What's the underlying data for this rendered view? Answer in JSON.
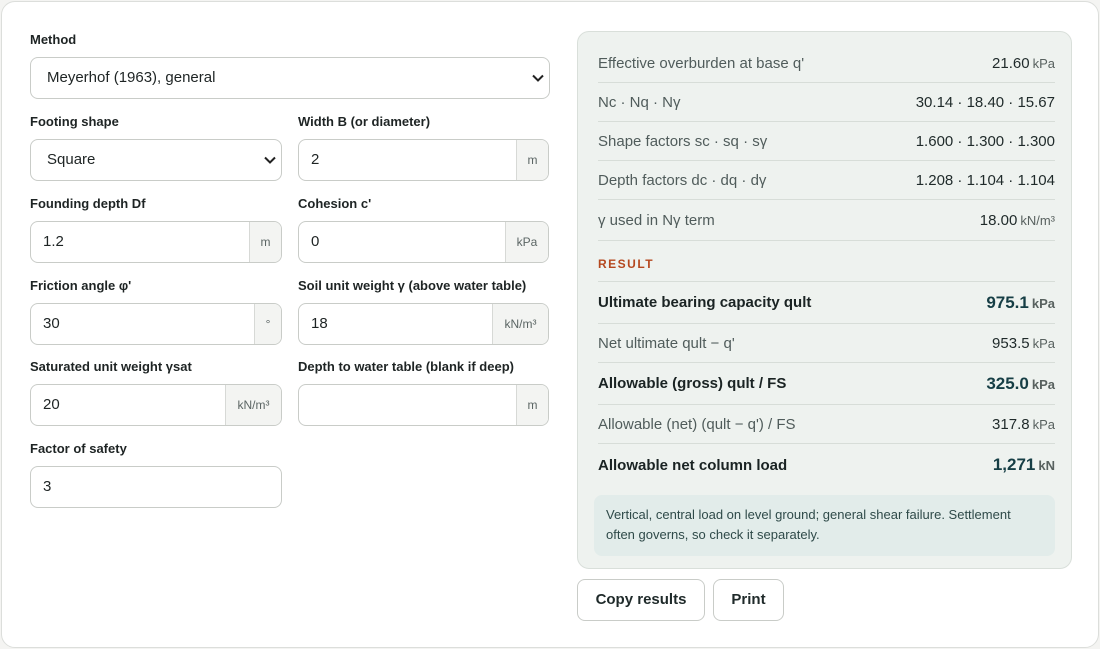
{
  "method": {
    "label": "Method",
    "value": "Meyerhof (1963), general"
  },
  "footing_shape": {
    "label": "Footing shape",
    "value": "Square"
  },
  "width": {
    "label": "Width B (or diameter)",
    "value": "2",
    "unit": "m"
  },
  "founding_depth": {
    "label": "Founding depth Df",
    "value": "1.2",
    "unit": "m"
  },
  "cohesion": {
    "label": "Cohesion c'",
    "value": "0",
    "unit": "kPa"
  },
  "friction_angle": {
    "label": "Friction angle φ'",
    "value": "30",
    "unit": "°"
  },
  "unit_weight": {
    "label": "Soil unit weight γ (above water table)",
    "value": "18",
    "unit": "kN/m³"
  },
  "sat_unit_weight": {
    "label": "Saturated unit weight γsat",
    "value": "20",
    "unit": "kN/m³"
  },
  "water_table": {
    "label": "Depth to water table (blank if deep)",
    "value": "",
    "unit": "m"
  },
  "factor_of_safety": {
    "label": "Factor of safety",
    "value": "3"
  },
  "results": {
    "rows": [
      {
        "label": "Effective overburden at base q'",
        "value": "21.60",
        "unit": "kPa"
      },
      {
        "label": "Nc · Nq · Nγ",
        "value": "30.14 · 18.40 · 15.67",
        "unit": ""
      },
      {
        "label": "Shape factors sc · sq · sγ",
        "value": "1.600 · 1.300 · 1.300",
        "unit": ""
      },
      {
        "label": "Depth factors dc · dq · dγ",
        "value": "1.208 · 1.104 · 1.104",
        "unit": ""
      },
      {
        "label": "γ used in Nγ term",
        "value": "18.00",
        "unit": "kN/m³"
      }
    ],
    "section_title": "RESULT",
    "qult": {
      "label": "Ultimate bearing capacity qult",
      "value": "975.1",
      "unit": "kPa"
    },
    "net_qult": {
      "label": "Net ultimate qult − q'",
      "value": "953.5",
      "unit": "kPa"
    },
    "allow_gross": {
      "label": "Allowable (gross) qult / FS",
      "value": "325.0",
      "unit": "kPa"
    },
    "allow_net": {
      "label": "Allowable (net) (qult − q') / FS",
      "value": "317.8",
      "unit": "kPa"
    },
    "column_load": {
      "label": "Allowable net column load",
      "value": "1,271",
      "unit": "kN"
    },
    "note": "Vertical, central load on level ground; general shear failure. Settlement often governs, so check it separately."
  },
  "buttons": {
    "copy": "Copy results",
    "print": "Print"
  }
}
